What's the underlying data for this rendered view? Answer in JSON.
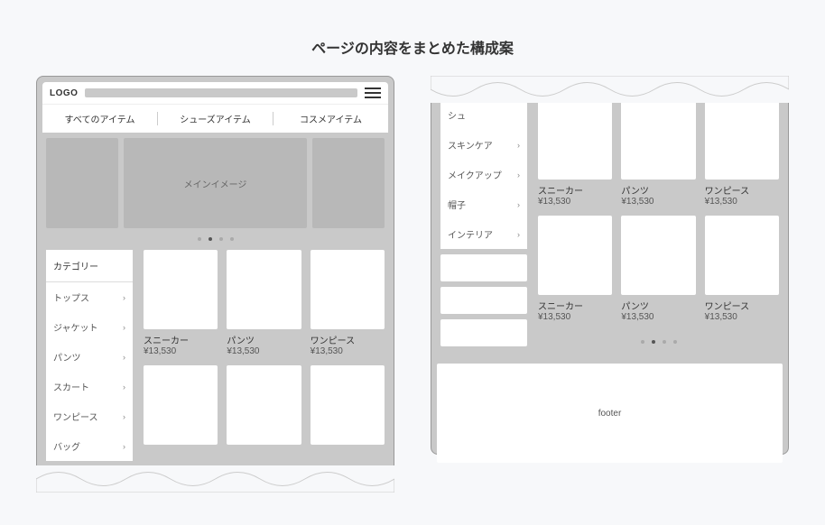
{
  "title": "ページの内容をまとめた構成案",
  "logo": "LOGO",
  "hero_label": "メインイメージ",
  "footer_label": "footer",
  "nav": {
    "items": [
      "すべてのアイテム",
      "シューズアイテム",
      "コスメアイテム"
    ]
  },
  "sidebar": {
    "heading": "カテゴリー",
    "items_left": [
      "トップス",
      "ジャケット",
      "パンツ",
      "スカート",
      "ワンピース",
      "バッグ"
    ],
    "items_right": [
      "シュ",
      "スキンケア",
      "メイクアップ",
      "帽子",
      "インテリア"
    ]
  },
  "products": {
    "row1": [
      {
        "name": "スニーカー",
        "price": "¥13,530"
      },
      {
        "name": "パンツ",
        "price": "¥13,530"
      },
      {
        "name": "ワンピース",
        "price": "¥13,530"
      }
    ],
    "row2": [
      {
        "name": "スニーカー",
        "price": "¥13,530"
      },
      {
        "name": "パンツ",
        "price": "¥13,530"
      },
      {
        "name": "ワンピース",
        "price": "¥13,530"
      }
    ]
  }
}
